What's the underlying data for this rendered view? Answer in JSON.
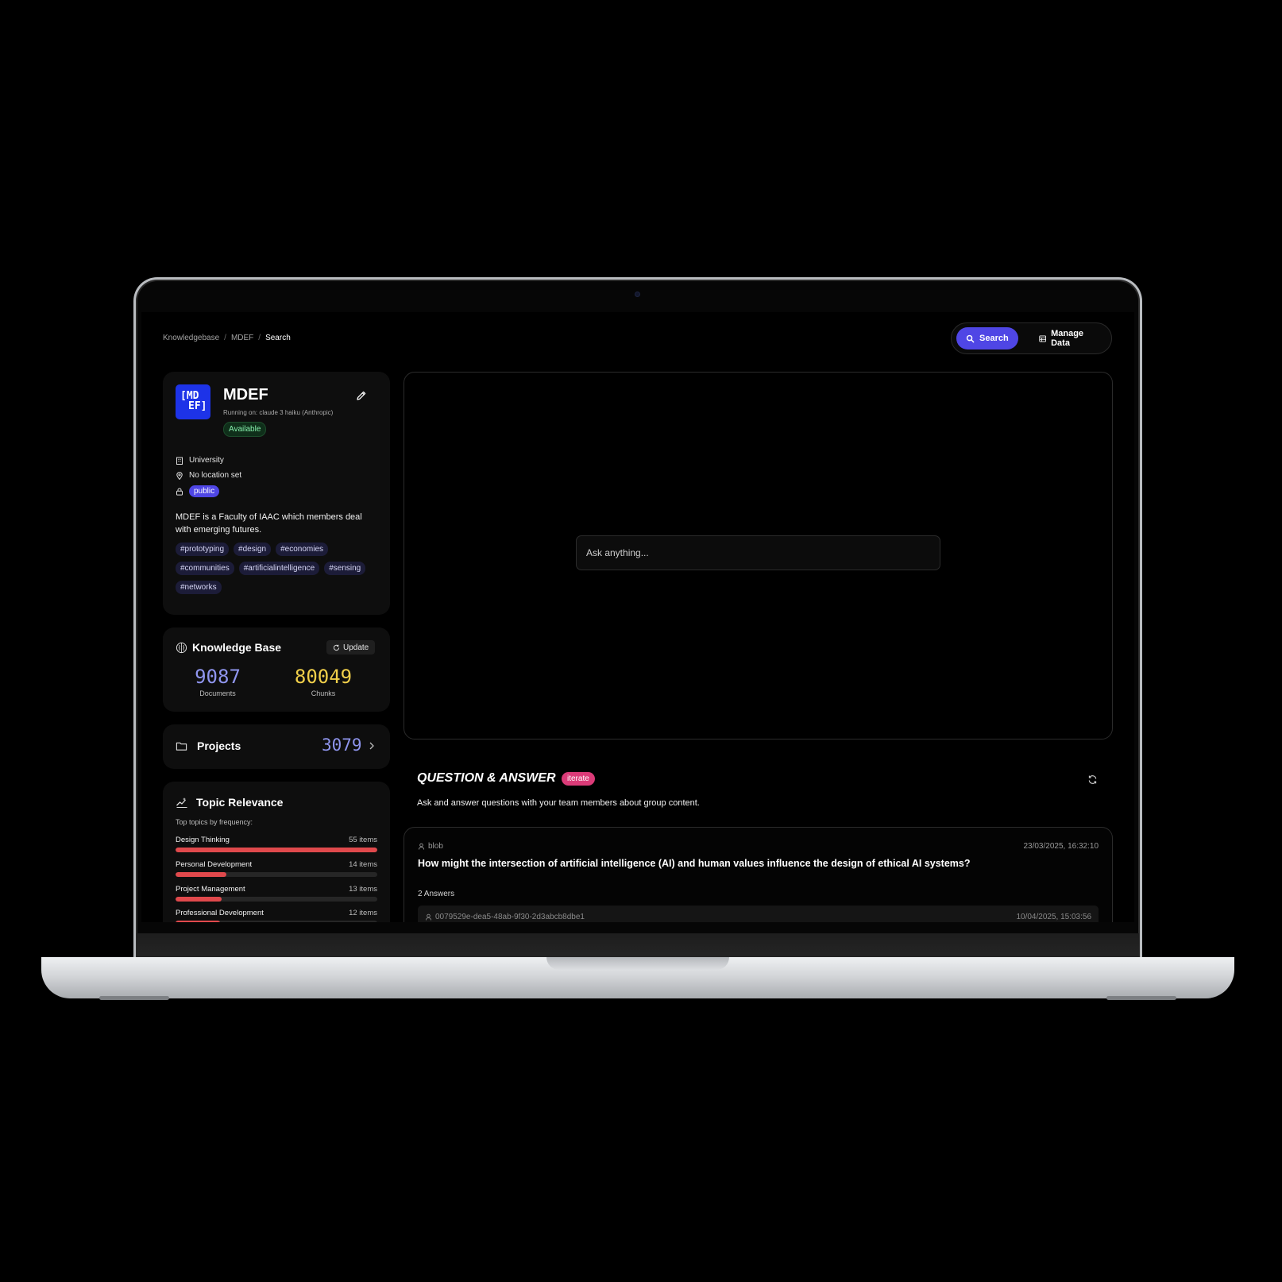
{
  "breadcrumb": [
    "Knowledgebase",
    "MDEF",
    "Search"
  ],
  "nav": {
    "search_label": "Search",
    "manage_label": "Manage Data"
  },
  "profile": {
    "logo_line1": "[MD",
    "logo_line2": "EF]",
    "name": "MDEF",
    "running_on": "Running on: claude 3 haiku (Anthropic)",
    "status": "Available",
    "type": "University",
    "location": "No location set",
    "visibility": "public",
    "description": "MDEF is a Faculty of IAAC which members deal with emerging futures.",
    "tags": [
      "#prototyping",
      "#design",
      "#economies",
      "#communities",
      "#artificialintelligence",
      "#sensing",
      "#networks"
    ]
  },
  "knowledge_base": {
    "title": "Knowledge Base",
    "update_label": "Update",
    "documents": "9087",
    "documents_label": "Documents",
    "chunks": "80049",
    "chunks_label": "Chunks"
  },
  "projects": {
    "title": "Projects",
    "count": "3079"
  },
  "topics": {
    "title": "Topic Relevance",
    "subtitle": "Top topics by frequency:",
    "items": [
      {
        "name": "Design Thinking",
        "count": "55 items",
        "fraction": 1.0
      },
      {
        "name": "Personal Development",
        "count": "14 items",
        "fraction": 0.25
      },
      {
        "name": "Project Management",
        "count": "13 items",
        "fraction": 0.23
      },
      {
        "name": "Professional Development",
        "count": "12 items",
        "fraction": 0.22
      }
    ]
  },
  "search": {
    "placeholder": "Ask anything..."
  },
  "qa": {
    "title": "QUESTION & ANSWER",
    "badge": "iterate",
    "subtitle": "Ask and answer questions with your team members about group content.",
    "question": {
      "author": "blob",
      "date": "23/03/2025, 16:32:10",
      "text": "How might the intersection of artificial intelligence (AI) and human values influence the design of ethical AI systems?",
      "answer_count": "2 Answers",
      "first_answer_author": "0079529e-dea5-48ab-9f30-2d3abcb8dbe1",
      "first_answer_date": "10/04/2025, 15:03:56"
    }
  },
  "colors": {
    "accent": "#4f46e5",
    "documents": "#8f95ee",
    "chunks": "#f0cf4a",
    "topic_bar": "#e0494c",
    "badge": "#db3b78",
    "status": "#86efac"
  }
}
